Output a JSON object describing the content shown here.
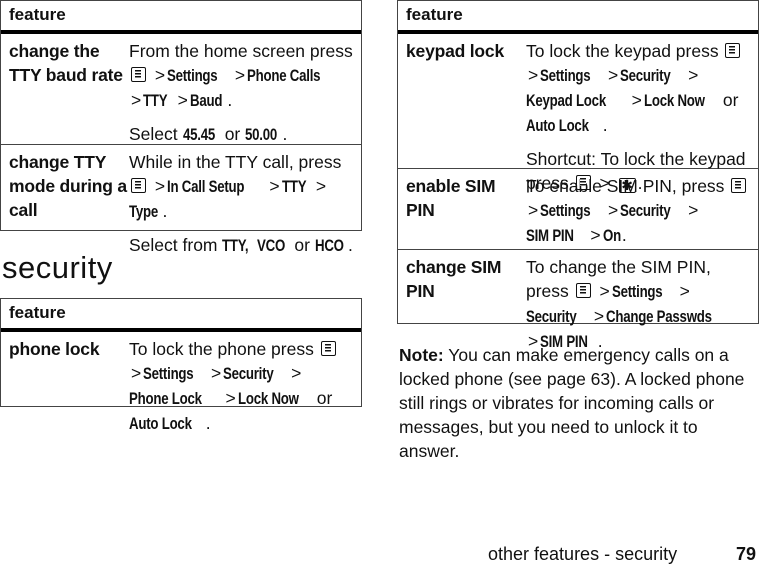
{
  "tables": {
    "tty": {
      "header": "feature",
      "rows": [
        {
          "feature": "change the TTY baud rate",
          "d1_pre": "From the home screen press",
          "path1": "Settings",
          "path2": "Phone Calls",
          "path3": "TTY",
          "path4": "Baud",
          "select_pre": "Select",
          "opt1": "45.45",
          "or": "or",
          "opt2": "50.00"
        },
        {
          "feature": "change TTY mode during a call",
          "d1_pre": "While in the TTY call, press",
          "path1": "In Call Setup",
          "path2": "TTY",
          "path3": "Type",
          "select_pre": "Select from",
          "opt1": "TTY,",
          "opt2": "VCO",
          "or": "or",
          "opt3": "HCO"
        }
      ]
    },
    "security": {
      "header": "feature",
      "rows": [
        {
          "feature": "phone lock",
          "d1_pre": "To lock the phone press",
          "path1": "Settings",
          "path2": "Security",
          "path3": "Phone Lock",
          "opt1": "Lock Now",
          "or": "or",
          "opt2": "Auto Lock"
        }
      ]
    },
    "security_right": {
      "header": "feature",
      "rows": [
        {
          "feature": "keypad lock",
          "d1_pre": "To lock the keypad press",
          "path1": "Settings",
          "path2": "Security",
          "path3": "Keypad Lock",
          "opt1": "Lock Now",
          "or": "or",
          "opt2": "Auto Lock",
          "shortcut_label": "Shortcut:",
          "shortcut_text": "To lock the keypad press"
        },
        {
          "feature": "enable SIM PIN",
          "d1_pre": "To enable SIM PIN, press",
          "path1": "Settings",
          "path2": "Security",
          "path3": "SIM PIN",
          "path4": "On"
        },
        {
          "feature": "change SIM PIN",
          "d1_pre": "To change the SIM PIN, press",
          "path1": "Settings",
          "path2": "Security",
          "path3": "Change Passwds",
          "path4": "SIM PIN"
        }
      ]
    }
  },
  "section_title": "security",
  "note": {
    "label": "Note:",
    "text": "You can make emergency calls on a locked phone (see page 63). A locked phone still rings or vibrates for incoming calls or messages, but you need to unlock it to answer."
  },
  "footer": {
    "section": "other features - security",
    "page_number": "79"
  },
  "icons": {
    "menu_key": "menu-key-icon",
    "star_key": "star-key-icon",
    "star_glyph": "✱",
    "separator": ">"
  }
}
